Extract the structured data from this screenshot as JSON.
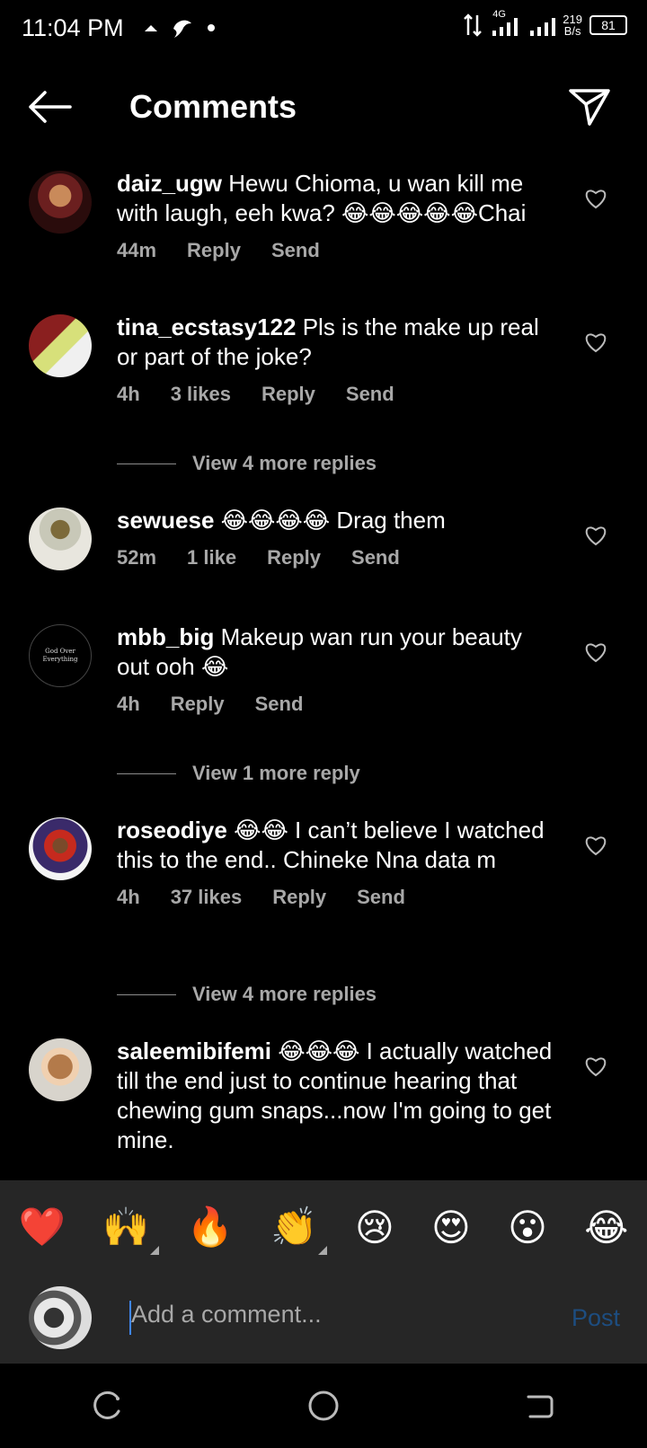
{
  "status_bar": {
    "time": "11:04 PM",
    "network_type": "4G",
    "net_speed_value": "219",
    "net_speed_unit": "B/s",
    "battery": "81"
  },
  "header": {
    "title": "Comments"
  },
  "comments": [
    {
      "username": "daiz_ugw",
      "text": "Hewu Chioma, u wan kill me with laugh, eeh kwa? 😂😂😂😂😂Chai",
      "time": "44m",
      "likes": "",
      "reply": "Reply",
      "send": "Send",
      "view_more": ""
    },
    {
      "username": "tina_ecstasy122",
      "text": "Pls is the make up real or part of the joke?",
      "time": "4h",
      "likes": "3 likes",
      "reply": "Reply",
      "send": "Send",
      "view_more": "View 4 more replies"
    },
    {
      "username": "sewuese",
      "text": "😂😂😂😂 Drag them",
      "time": "52m",
      "likes": "1 like",
      "reply": "Reply",
      "send": "Send",
      "view_more": ""
    },
    {
      "username": "mbb_big",
      "text": "Makeup wan run your beauty out ooh 😂",
      "time": "4h",
      "likes": "",
      "reply": "Reply",
      "send": "Send",
      "view_more": "View 1 more reply",
      "avatar_text": "God Over Everything"
    },
    {
      "username": "roseodiye",
      "text": "😂😂 I can’t believe I watched this to the end.. Chineke Nna data m",
      "time": "4h",
      "likes": "37 likes",
      "reply": "Reply",
      "send": "Send",
      "view_more": "View 4 more replies"
    },
    {
      "username": "saleemibifemi",
      "text": "😂😂😂 I actually watched till the end just to continue hearing that chewing gum snaps...now I'm going to get mine.",
      "time": "",
      "likes": "",
      "reply": "",
      "send": "",
      "view_more": ""
    }
  ],
  "quick_reactions": [
    "❤️",
    "🙌",
    "🔥",
    "👏",
    "😢",
    "😍",
    "😮",
    "😂"
  ],
  "comment_input": {
    "placeholder": "Add a comment...",
    "post_label": "Post"
  },
  "icons": {
    "back": "arrow-left-icon",
    "send": "paper-plane-icon",
    "like": "heart-outline-icon",
    "nav_recents": "recents-icon",
    "nav_home": "home-circle-icon",
    "nav_back": "back-nav-icon"
  },
  "colors": {
    "background": "#000000",
    "secondary_text": "#a8a8a8",
    "bar_background": "#262626",
    "post_disabled": "#1d4d80",
    "caret": "#3f86f5"
  }
}
